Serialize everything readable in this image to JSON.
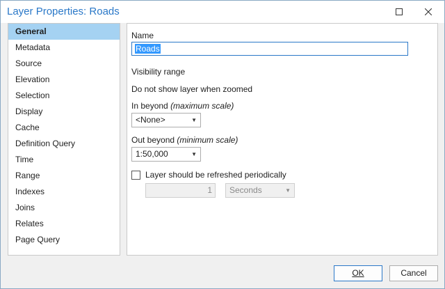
{
  "window": {
    "title": "Layer Properties: Roads",
    "maximize_icon": "maximize-icon",
    "close_icon": "close-icon"
  },
  "sidebar": {
    "items": [
      {
        "label": "General",
        "selected": true
      },
      {
        "label": "Metadata"
      },
      {
        "label": "Source"
      },
      {
        "label": "Elevation"
      },
      {
        "label": "Selection"
      },
      {
        "label": "Display"
      },
      {
        "label": "Cache"
      },
      {
        "label": "Definition Query"
      },
      {
        "label": "Time"
      },
      {
        "label": "Range"
      },
      {
        "label": "Indexes"
      },
      {
        "label": "Joins"
      },
      {
        "label": "Relates"
      },
      {
        "label": "Page Query"
      }
    ]
  },
  "general": {
    "name_label": "Name",
    "name_value": "Roads",
    "visibility_heading": "Visibility range",
    "zoom_heading": "Do not show layer when zoomed",
    "in_beyond_label": "In beyond",
    "in_beyond_hint": "(maximum scale)",
    "in_beyond_value": "<None>",
    "out_beyond_label": "Out beyond",
    "out_beyond_hint": "(minimum scale)",
    "out_beyond_value": "1:50,000",
    "refresh_label": "Layer should be refreshed periodically",
    "refresh_checked": false,
    "refresh_interval": "1",
    "refresh_unit": "Seconds"
  },
  "footer": {
    "ok_label": "OK",
    "cancel_label": "Cancel"
  },
  "colors": {
    "accent": "#2a78c8",
    "selection": "#a5d2f2"
  }
}
